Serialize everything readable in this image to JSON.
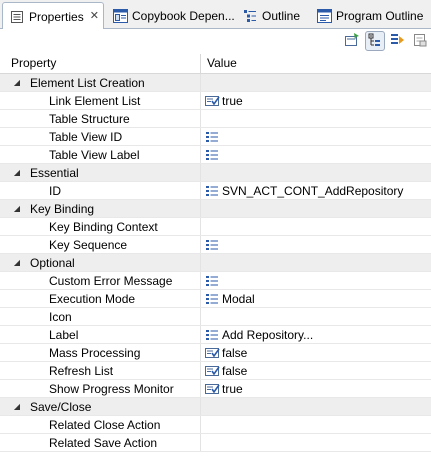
{
  "tabs": [
    {
      "label": "Properties",
      "icon": "properties-icon",
      "active": true,
      "closable": true
    },
    {
      "label": "Copybook Depen...",
      "icon": "copybook-icon",
      "active": false,
      "closable": false
    },
    {
      "label": "Outline",
      "icon": "outline-icon",
      "active": false,
      "closable": false
    },
    {
      "label": "Program Outline",
      "icon": "program-outline-icon",
      "active": false,
      "closable": false
    }
  ],
  "toolbar": [
    {
      "name": "pin-icon",
      "pressed": false
    },
    {
      "name": "show-categories-icon",
      "pressed": true
    },
    {
      "name": "show-advanced-icon",
      "pressed": false
    },
    {
      "name": "restore-default-icon",
      "pressed": false
    }
  ],
  "table": {
    "headers": {
      "property": "Property",
      "value": "Value"
    },
    "rows": [
      {
        "type": "category",
        "label": "Element List Creation"
      },
      {
        "type": "prop",
        "label": "Link Element List",
        "icon": "boolean-icon",
        "value": "true"
      },
      {
        "type": "prop",
        "label": "Table Structure",
        "icon": "",
        "value": ""
      },
      {
        "type": "prop",
        "label": "Table View ID",
        "icon": "text-icon",
        "value": ""
      },
      {
        "type": "prop",
        "label": "Table View Label",
        "icon": "text-icon",
        "value": ""
      },
      {
        "type": "category",
        "label": "Essential"
      },
      {
        "type": "prop",
        "label": "ID",
        "icon": "text-icon",
        "value": "SVN_ACT_CONT_AddRepository"
      },
      {
        "type": "category",
        "label": "Key Binding"
      },
      {
        "type": "prop",
        "label": "Key Binding Context",
        "icon": "",
        "value": ""
      },
      {
        "type": "prop",
        "label": "Key Sequence",
        "icon": "text-icon",
        "value": ""
      },
      {
        "type": "category",
        "label": "Optional"
      },
      {
        "type": "prop",
        "label": "Custom Error Message",
        "icon": "text-icon",
        "value": ""
      },
      {
        "type": "prop",
        "label": "Execution Mode",
        "icon": "text-icon",
        "value": "Modal"
      },
      {
        "type": "prop",
        "label": "Icon",
        "icon": "",
        "value": ""
      },
      {
        "type": "prop",
        "label": "Label",
        "icon": "text-icon",
        "value": "Add Repository..."
      },
      {
        "type": "prop",
        "label": "Mass Processing",
        "icon": "boolean-icon",
        "value": "false"
      },
      {
        "type": "prop",
        "label": "Refresh List",
        "icon": "boolean-icon",
        "value": "false"
      },
      {
        "type": "prop",
        "label": "Show Progress Monitor",
        "icon": "boolean-icon",
        "value": "true"
      },
      {
        "type": "category",
        "label": "Save/Close"
      },
      {
        "type": "prop",
        "label": "Related Close Action",
        "icon": "",
        "value": ""
      },
      {
        "type": "prop",
        "label": "Related Save Action",
        "icon": "",
        "value": ""
      }
    ]
  },
  "colors": {
    "category_bg": "#eeeeee",
    "tab_border": "#a9b7c9",
    "icon_blue": "#2a5aa8"
  }
}
